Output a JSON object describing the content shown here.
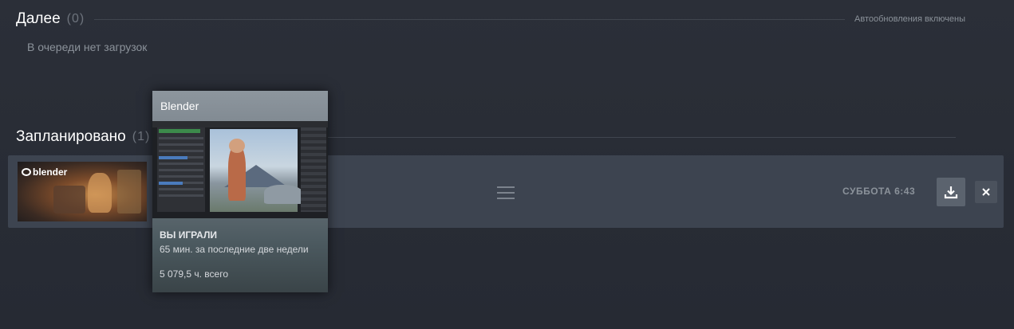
{
  "next_section": {
    "title": "Далее",
    "count": "(0)",
    "status": "Автообновления включены",
    "empty_message": "В очереди нет загрузок"
  },
  "scheduled_section": {
    "title": "Запланировано",
    "count": "(1)"
  },
  "queue_item": {
    "thumb_logo": "blender",
    "scheduled_time": "СУББОТА 6:43",
    "download_icon": "download-icon",
    "remove_icon": "close-icon"
  },
  "hover_card": {
    "title": "Blender",
    "played_label": "ВЫ ИГРАЛИ",
    "recent_playtime": "65 мин. за последние две недели",
    "total_playtime": "5 079,5 ч. всего"
  },
  "colors": {
    "background": "#2b2f38",
    "row_background": "#3d4450",
    "muted_text": "#8b929a"
  }
}
